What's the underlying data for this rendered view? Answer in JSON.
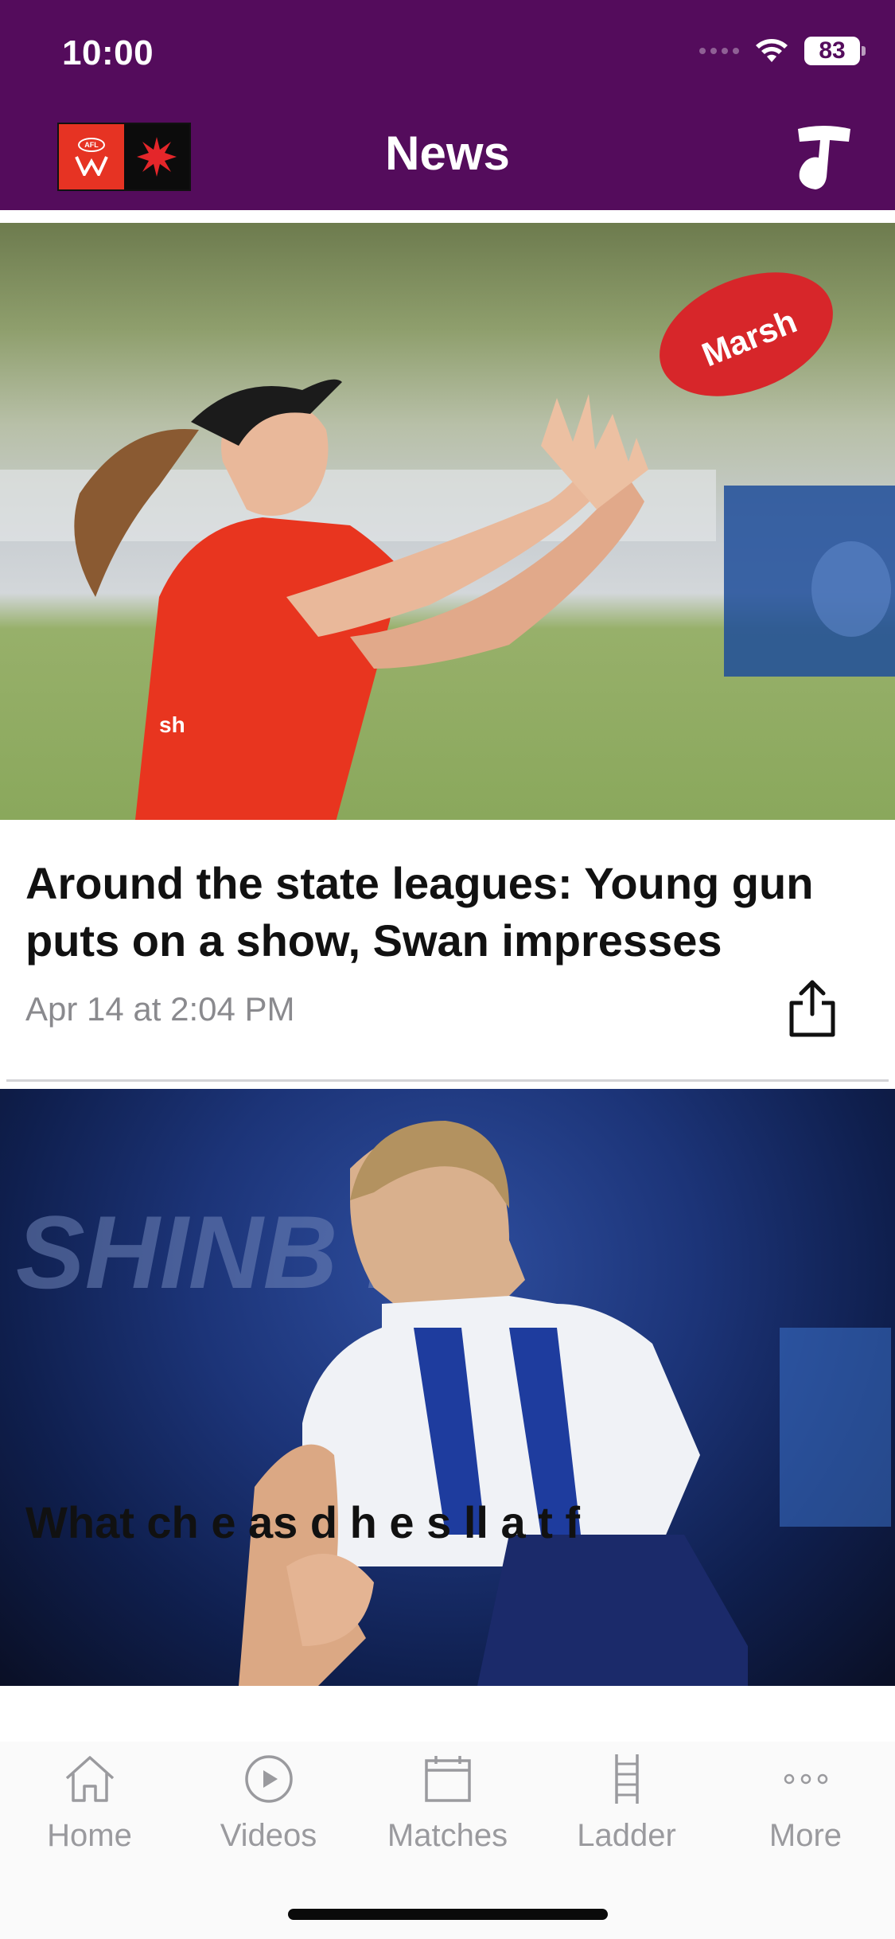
{
  "status_bar": {
    "time": "10:00",
    "battery": "83"
  },
  "header": {
    "title": "News",
    "logo_text": "AFL",
    "background_color": "#540c5c"
  },
  "articles": [
    {
      "headline": "Around the state leagues: Young gun puts on a show, Swan impresses",
      "date": "Apr 14 at 2:04 PM",
      "share_icon": "share-icon",
      "photo_jersey_text": "sh",
      "photo_ball_text": "Marsh"
    },
    {
      "headline_visible": "What ch e as d h e s ll a t f",
      "photo_banner_text": "SHINB ER"
    }
  ],
  "tabbar": {
    "items": [
      {
        "label": "Home",
        "icon": "home-icon"
      },
      {
        "label": "Videos",
        "icon": "play-icon"
      },
      {
        "label": "Matches",
        "icon": "calendar-icon"
      },
      {
        "label": "Ladder",
        "icon": "ladder-icon"
      },
      {
        "label": "More",
        "icon": "more-icon"
      }
    ]
  }
}
